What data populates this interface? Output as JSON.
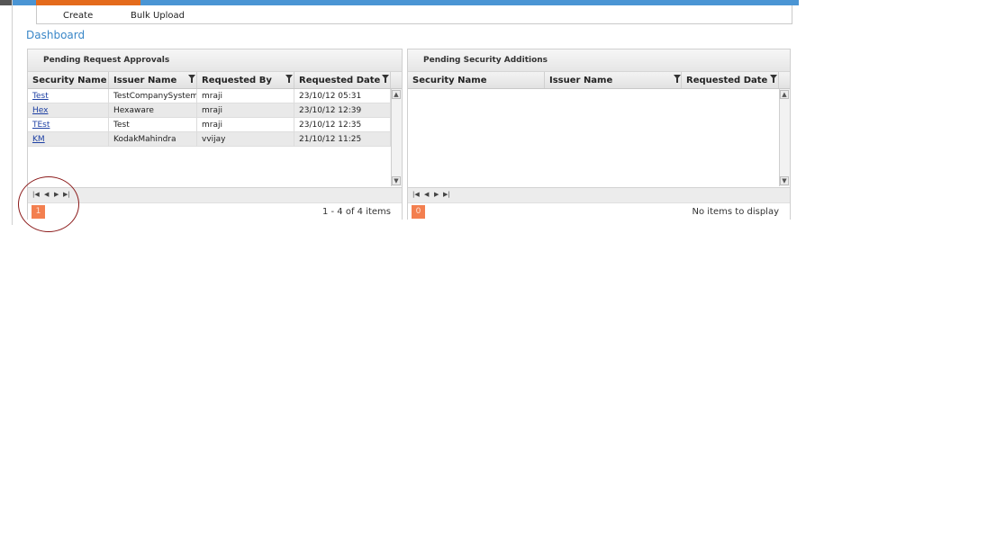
{
  "nav": {
    "create_label": "Create",
    "bulk_upload_label": "Bulk Upload"
  },
  "page": {
    "title": "Dashboard"
  },
  "pending_requests": {
    "title": "Pending Request Approvals",
    "columns": [
      "Security Name",
      "Issuer Name",
      "Requested By",
      "Requested Date"
    ],
    "rows": [
      [
        "Test",
        "TestCompanySystem",
        "mraji",
        "23/10/12 05:31"
      ],
      [
        "Hex",
        "Hexaware",
        "mraji",
        "23/10/12 12:39"
      ],
      [
        "TEst",
        "Test",
        "mraji",
        "23/10/12 12:35"
      ],
      [
        "KM",
        "KodakMahindra",
        "vvijay",
        "21/10/12 11:25"
      ]
    ],
    "current_page": "1",
    "items_text": "1 - 4 of 4 items"
  },
  "pending_additions": {
    "title": "Pending Security Additions",
    "columns": [
      "Security Name",
      "Issuer Name",
      "Requested Date"
    ],
    "current_page": "0",
    "items_text": "No items to display"
  },
  "pager_icons": [
    "first-page-icon",
    "prev-page-icon",
    "next-page-icon",
    "last-page-icon"
  ],
  "colors": {
    "accent_blue": "#4a95d4",
    "active_tab": "#e46b1c",
    "page_button": "#f37f4f",
    "link": "#1c3fa3",
    "annotation_circle": "#8b1a1a"
  }
}
